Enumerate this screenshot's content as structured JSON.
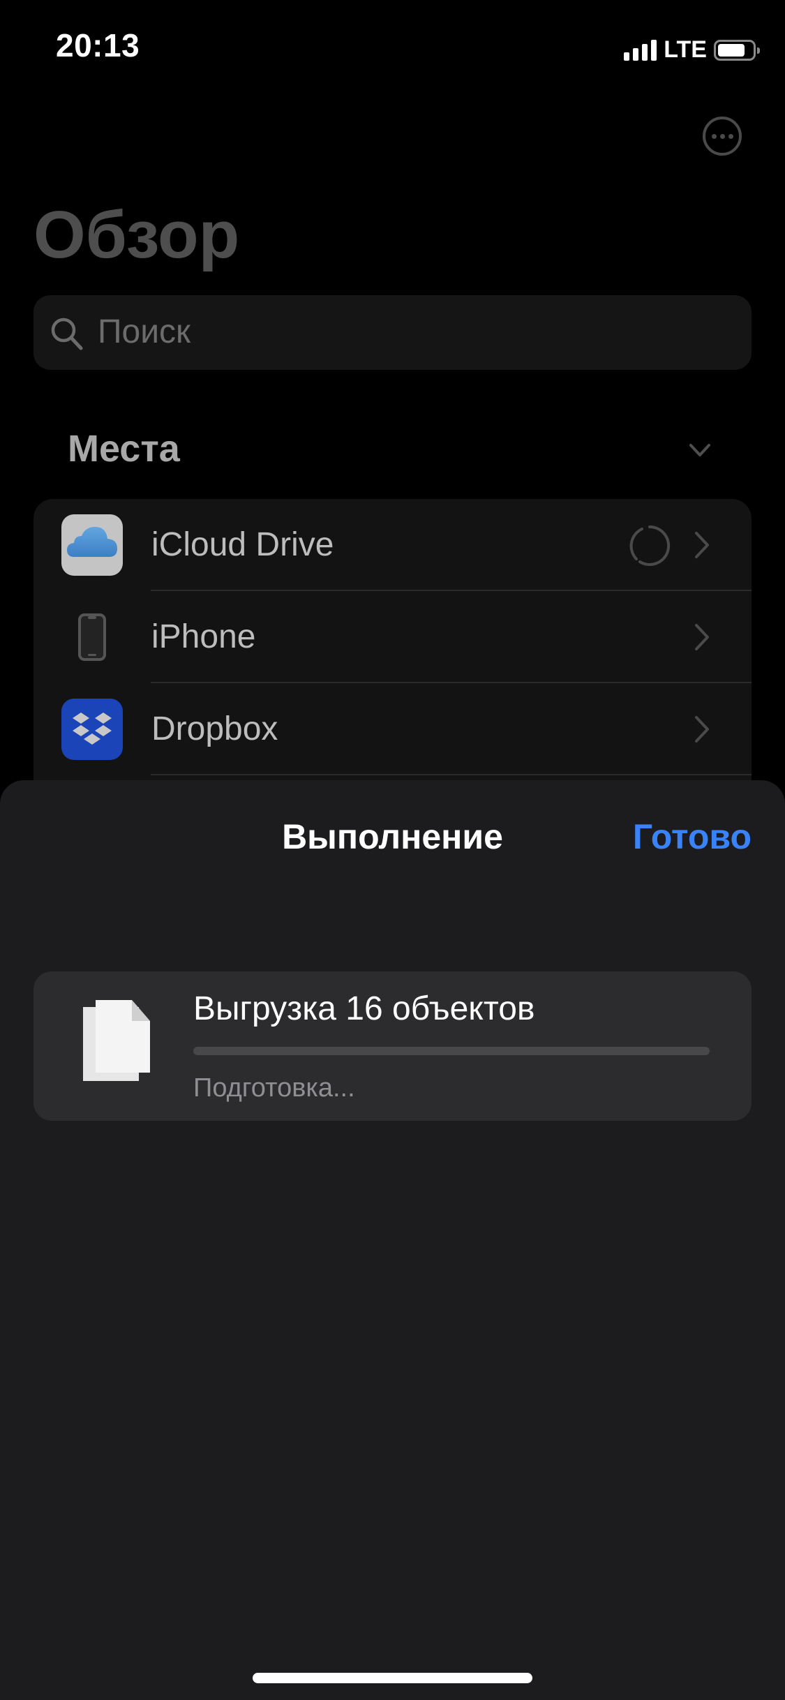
{
  "status_bar": {
    "time": "20:13",
    "network": "LTE",
    "signal_bars": 4,
    "battery_level": 0.8
  },
  "header": {
    "more_icon": "ellipsis-circle-icon",
    "title": "Обзор"
  },
  "search": {
    "placeholder": "Поиск",
    "value": ""
  },
  "locations": {
    "section_title": "Места",
    "collapse_icon": "chevron-down-icon",
    "items": [
      {
        "label": "iCloud Drive",
        "icon": "icloud-icon",
        "loading": true
      },
      {
        "label": "iPhone",
        "icon": "iphone-icon",
        "loading": false
      },
      {
        "label": "Dropbox",
        "icon": "dropbox-icon",
        "loading": false
      }
    ]
  },
  "progress_sheet": {
    "title": "Выполнение",
    "done_label": "Готово",
    "task": {
      "title": "Выгрузка 16 объектов",
      "status": "Подготовка...",
      "progress": 0,
      "icon": "documents-icon"
    }
  },
  "colors": {
    "accent": "#3a82f7",
    "sheet_bg": "#1c1c1e",
    "card_bg": "#2c2c2e",
    "dropbox_blue": "#1a44b8"
  }
}
